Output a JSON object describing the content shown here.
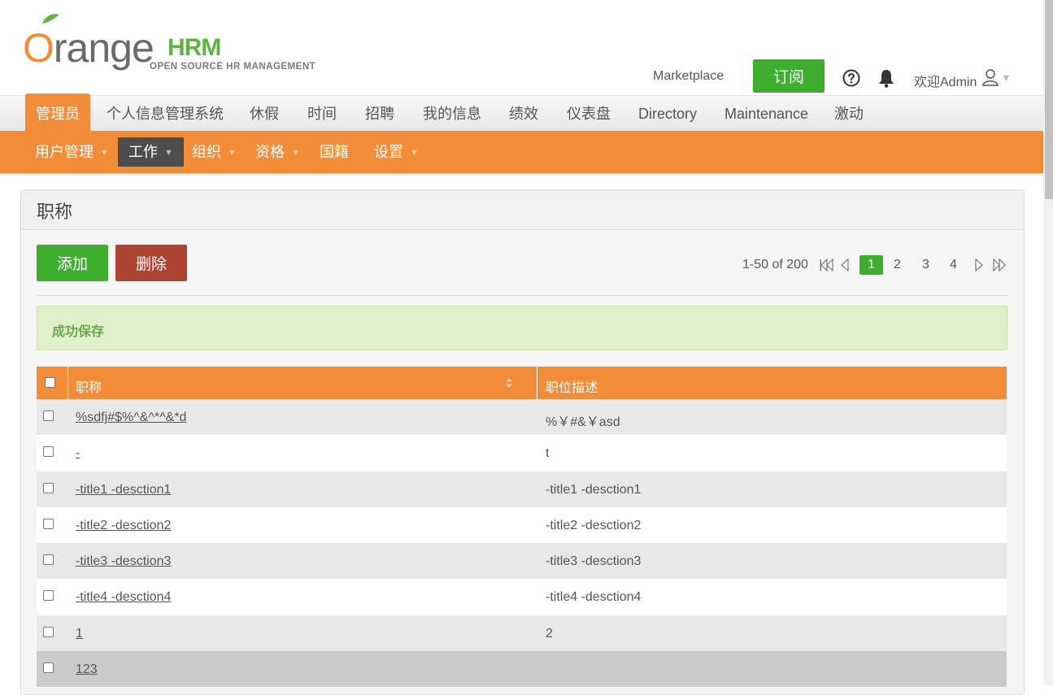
{
  "header": {
    "logo": {
      "letter": "O",
      "range": "range",
      "hrm": "HRM",
      "subtitle": "OPEN SOURCE HR MANAGEMENT"
    },
    "marketplace": "Marketplace",
    "subscribe_label": "订阅",
    "welcome": "欢迎Admin",
    "icons": [
      "help-icon",
      "bell-icon",
      "user-icon",
      "caret-down-icon"
    ]
  },
  "top_nav": [
    {
      "label": "管理员",
      "active": true
    },
    {
      "label": "个人信息管理系统"
    },
    {
      "label": "休假"
    },
    {
      "label": "时间"
    },
    {
      "label": "招聘"
    },
    {
      "label": "我的信息"
    },
    {
      "label": "绩效"
    },
    {
      "label": "仪表盘"
    },
    {
      "label": "Directory"
    },
    {
      "label": "Maintenance"
    },
    {
      "label": "激动"
    }
  ],
  "sub_nav": [
    {
      "label": "用户管理",
      "caret": "▼"
    },
    {
      "label": "工作",
      "caret": "▼",
      "active": true
    },
    {
      "label": "组织",
      "caret": "▼"
    },
    {
      "label": "资格",
      "caret": "▼"
    },
    {
      "label": "国籍",
      "caret": ""
    },
    {
      "label": "设置",
      "caret": "▼"
    }
  ],
  "panel": {
    "title": "职称",
    "add_label": "添加",
    "delete_label": "删除",
    "pagination": {
      "range": "1-50 of 200",
      "pages": [
        "1",
        "2",
        "3",
        "4"
      ],
      "current": "1"
    },
    "success_message": "成功保存"
  },
  "table": {
    "headers": {
      "title": "职称",
      "description": "职位描述"
    },
    "rows": [
      {
        "title": "%sdfj#$%^&^*^&*d",
        "description": "%￥#&￥asd"
      },
      {
        "title": "-",
        "description": "t"
      },
      {
        "title": "-title1 -desction1",
        "description": "-title1 -desction1"
      },
      {
        "title": "-title2 -desction2",
        "description": "-title2 -desction2"
      },
      {
        "title": "-title3 -desction3",
        "description": "-title3 -desction3"
      },
      {
        "title": "-title4 -desction4",
        "description": "-title4 -desction4"
      },
      {
        "title": "1",
        "description": "2"
      },
      {
        "title": "123",
        "description": ""
      }
    ]
  },
  "colors": {
    "brand_orange": "#f28c38",
    "brand_green": "#3dae2e",
    "danger_red": "#ad4432",
    "success_bg": "#dff0c8",
    "dark_active": "#4d4d4d"
  }
}
